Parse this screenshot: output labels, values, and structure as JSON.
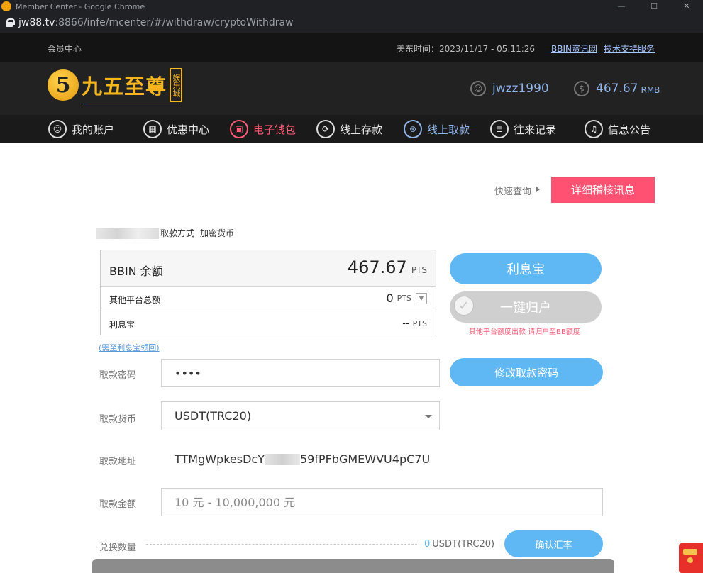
{
  "window": {
    "title": "Member Center - Google Chrome",
    "controls": [
      "—",
      "☐",
      "✕"
    ]
  },
  "url": {
    "host": "jw88.tv",
    "path": ":8866/infe/mcenter/#/withdraw/cryptoWithdraw"
  },
  "topbar": {
    "member_center": "会员中心",
    "time_label": "美东时间：2023/11/17 - 05:11:26",
    "link_news": "BBIN资讯网",
    "link_support": "技术支持服务"
  },
  "brand": {
    "logo_glyph": "5",
    "name": "九五至尊",
    "seal": "娱乐城"
  },
  "user": {
    "username": "jwzz1990",
    "balance": "467.67",
    "currency": "RMB"
  },
  "nav": [
    {
      "label": "我的账户",
      "icon": "user-icon",
      "glyph": "☺"
    },
    {
      "label": "优惠中心",
      "icon": "gift-icon",
      "glyph": "▦"
    },
    {
      "label": "电子钱包",
      "icon": "wallet-icon",
      "glyph": "▣"
    },
    {
      "label": "线上存款",
      "icon": "deposit-icon",
      "glyph": "⟳"
    },
    {
      "label": "线上取款",
      "icon": "withdraw-icon",
      "glyph": "⊛"
    },
    {
      "label": "往来记录",
      "icon": "record-icon",
      "glyph": "≣"
    },
    {
      "label": "信息公告",
      "icon": "bell-icon",
      "glyph": "♫"
    }
  ],
  "quick_query": "快速查询",
  "detail_button": "详细稽核讯息",
  "method": {
    "label": "取款方式",
    "value": "加密货币"
  },
  "balance_box": {
    "bbin_label": "BBIN 余额",
    "bbin_amount": "467.67",
    "unit": "PTS",
    "other_label": "其他平台总额",
    "other_amount": "0",
    "lixibao_label": "利息宝",
    "lixibao_amount": "--"
  },
  "back_link": "(需至利息宝领回)",
  "buttons": {
    "lixibao": "利息宝",
    "one_click": "一键归户",
    "change_password": "修改取款密码",
    "confirm_rate": "确认汇率"
  },
  "warn_text": "其他平台额度出款 请归户至BB额度",
  "form": {
    "password_label": "取款密码",
    "password_value": "••••",
    "currency_label": "取款货币",
    "currency_value": "USDT(TRC20)",
    "address_label": "取款地址",
    "address_start": "TTMgWpkesDcY",
    "address_end": "59fPFbGMEWVU4pC7U",
    "amount_label": "取款金额",
    "amount_placeholder": "10 元 - 10,000,000 元",
    "exchange_label": "兑换数量",
    "exchange_value": "0",
    "exchange_unit": "USDT(TRC20)"
  }
}
